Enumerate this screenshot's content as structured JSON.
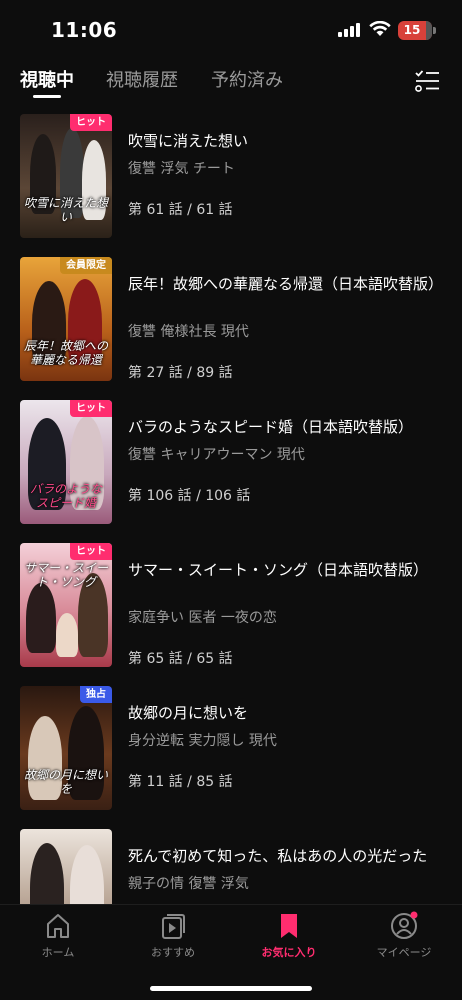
{
  "status": {
    "time": "11:06",
    "battery": "15"
  },
  "tabs": [
    {
      "label": "視聴中",
      "active": true
    },
    {
      "label": "視聴履歴",
      "active": false
    },
    {
      "label": "予約済み",
      "active": false
    }
  ],
  "header": {
    "edit_icon": "checklist-icon"
  },
  "items": [
    {
      "title": "吹雪に消えた想い",
      "tags": "復讐 浮気 チート",
      "progress": "第 61 話 / 61 話",
      "badge": "ヒット",
      "badge_color": "#ff2d6f",
      "poster_title": "吹雪に消えた想い",
      "poster_colors": [
        "#3a2a22",
        "#6b5a4a"
      ]
    },
    {
      "title": "辰年！故郷への華麗なる帰還（日本語吹替版）",
      "tags": "復讐 俺様社長 現代",
      "progress": "第 27 話 / 89 話",
      "badge": "会員限定",
      "badge_color": "#c88a1e",
      "poster_title": "辰年！故郷への華麗なる帰還",
      "poster_colors": [
        "#b8651c",
        "#e8a83a"
      ]
    },
    {
      "title": "バラのようなスピード婚（日本語吹替版）",
      "tags": "復讐 キャリアウーマン 現代",
      "progress": "第 106 話 / 106 話",
      "badge": "ヒット",
      "badge_color": "#ff2d6f",
      "poster_title": "バラのような スピード婚",
      "poster_colors": [
        "#d8d0d8",
        "#b58aa0"
      ]
    },
    {
      "title": " サマー・スイート・ソング（日本語吹替版）",
      "tags": "家庭争い 医者 一夜の恋",
      "progress": "第 65 話 / 65 話",
      "badge": "ヒット",
      "badge_color": "#ff2d6f",
      "poster_title": "サマー・スイート・ソング",
      "poster_colors": [
        "#e8b8c0",
        "#c85a6a"
      ]
    },
    {
      "title": "故郷の月に想いを",
      "tags": "身分逆転 実力隠し 現代",
      "progress": "第 11 話 / 85 話",
      "badge": "独占",
      "badge_color": "#3a5ae8",
      "poster_title": "故郷の月に想いを",
      "poster_colors": [
        "#3a2418",
        "#7a4a2a"
      ]
    },
    {
      "title": "死んで初めて知った、私はあの人の光だった",
      "tags": "親子の情 復讐 浮気",
      "progress": "",
      "badge": "",
      "badge_color": "#ff2d6f",
      "poster_title": "",
      "poster_colors": [
        "#e0d8d0",
        "#a89888"
      ]
    }
  ],
  "nav": [
    {
      "label": "ホーム",
      "icon": "home-icon",
      "active": false
    },
    {
      "label": "おすすめ",
      "icon": "video-stack-icon",
      "active": false
    },
    {
      "label": "お気に入り",
      "icon": "bookmark-icon",
      "active": true
    },
    {
      "label": "マイページ",
      "icon": "profile-icon",
      "active": false
    }
  ],
  "colors": {
    "accent": "#ff2d6f",
    "background": "#0d0d0d",
    "muted": "#9a9a9a"
  }
}
